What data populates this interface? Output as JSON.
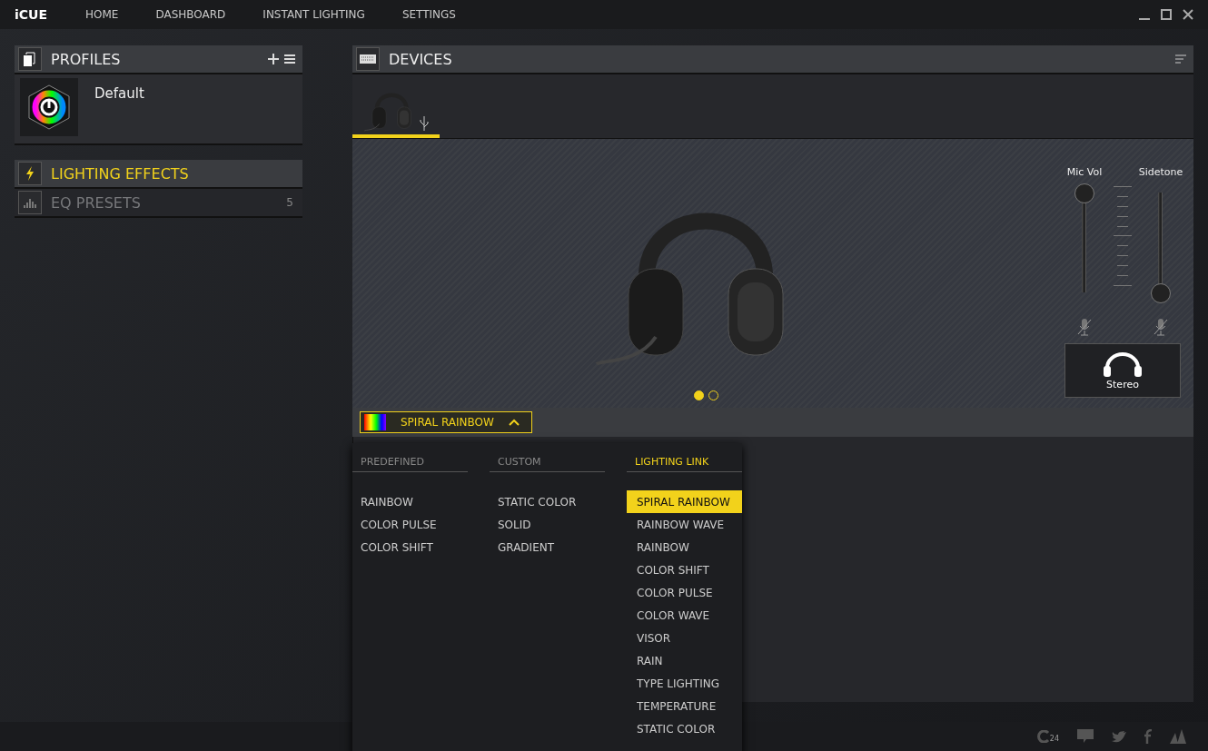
{
  "app": {
    "logo": "iCUE"
  },
  "nav": [
    {
      "label": "HOME",
      "selected": false
    },
    {
      "label": "DASHBOARD",
      "selected": false
    },
    {
      "label": "INSTANT LIGHTING",
      "selected": false
    },
    {
      "label": "SETTINGS",
      "selected": false
    }
  ],
  "profiles": {
    "title": "PROFILES",
    "items": [
      {
        "name": "Default"
      }
    ]
  },
  "sections": [
    {
      "label": "LIGHTING EFFECTS",
      "selected": true
    },
    {
      "label": "EQ PRESETS",
      "selected": false,
      "count": "5"
    }
  ],
  "devices": {
    "title": "DEVICES",
    "tabs": [
      {
        "selected": true
      }
    ],
    "carousel": [
      {
        "selected": true
      },
      {
        "selected": false
      }
    ]
  },
  "sliders": [
    {
      "label": "Mic Vol",
      "level": 1
    },
    {
      "label": "Sidetone",
      "level": 0
    }
  ],
  "mode_button": {
    "label": "Stereo"
  },
  "effect_select": {
    "value": "SPIRAL RAINBOW",
    "expanded": true
  },
  "effect_menu": [
    {
      "header": "PREDEFINED",
      "active": false,
      "items": [
        {
          "label": "RAINBOW",
          "selected": false
        },
        {
          "label": "COLOR PULSE",
          "selected": false
        },
        {
          "label": "COLOR SHIFT",
          "selected": false
        }
      ]
    },
    {
      "header": "CUSTOM",
      "active": false,
      "items": [
        {
          "label": "STATIC COLOR",
          "selected": false
        },
        {
          "label": "SOLID",
          "selected": false
        },
        {
          "label": "GRADIENT",
          "selected": false
        }
      ]
    },
    {
      "header": "LIGHTING LINK",
      "active": true,
      "items": [
        {
          "label": "SPIRAL RAINBOW",
          "selected": true
        },
        {
          "label": "RAINBOW WAVE",
          "selected": false
        },
        {
          "label": "RAINBOW",
          "selected": false
        },
        {
          "label": "COLOR SHIFT",
          "selected": false
        },
        {
          "label": "COLOR PULSE",
          "selected": false
        },
        {
          "label": "COLOR WAVE",
          "selected": false
        },
        {
          "label": "VISOR",
          "selected": false
        },
        {
          "label": "RAIN",
          "selected": false
        },
        {
          "label": "TYPE LIGHTING",
          "selected": false
        },
        {
          "label": "TEMPERATURE",
          "selected": false
        },
        {
          "label": "STATIC COLOR",
          "selected": false
        }
      ]
    }
  ],
  "footer": {
    "support_badge": "24"
  }
}
